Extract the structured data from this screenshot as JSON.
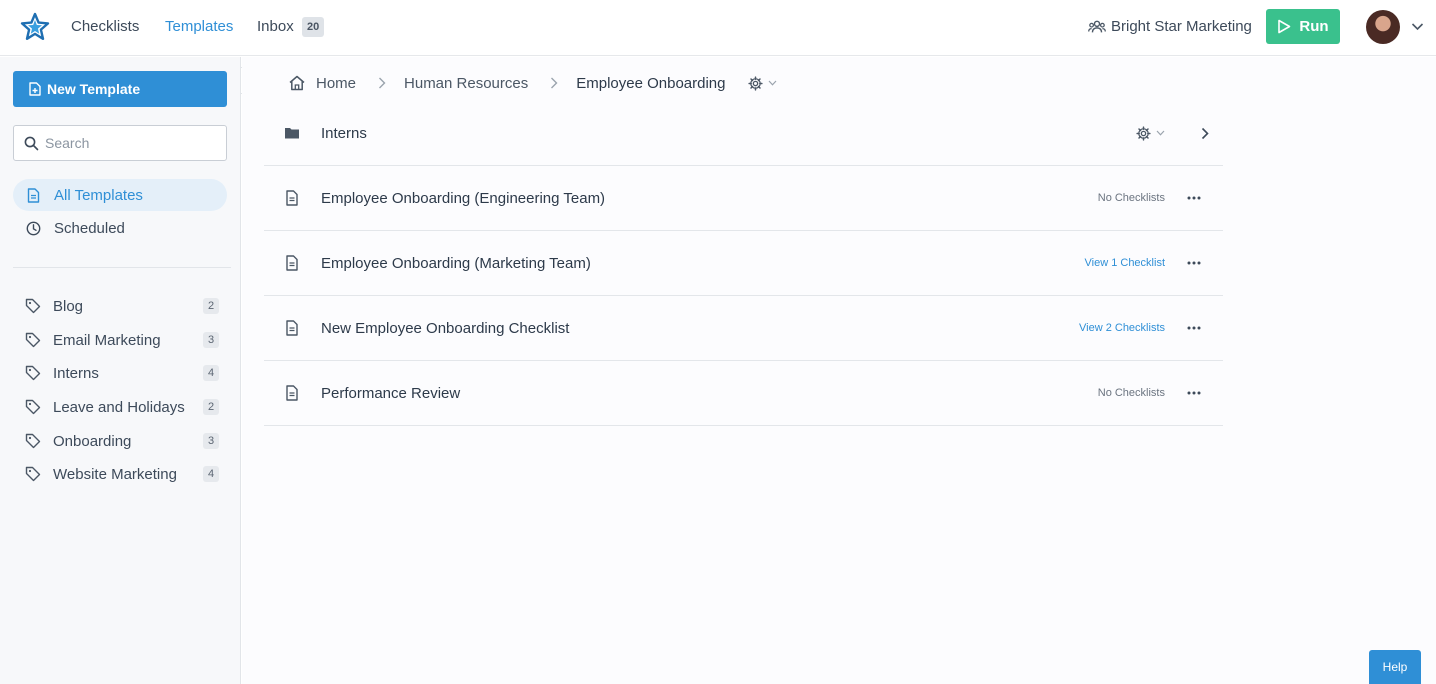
{
  "topbar": {
    "nav": {
      "checklists": "Checklists",
      "templates": "Templates",
      "inbox": "Inbox",
      "inbox_count": "20"
    },
    "organization": "Bright Star Marketing",
    "run_label": "Run"
  },
  "sidebar": {
    "new_template_label": "New Template",
    "search_placeholder": "Search",
    "items": [
      {
        "label": "All Templates",
        "icon": "document-icon",
        "active": true
      },
      {
        "label": "Scheduled",
        "icon": "clock-icon",
        "active": false
      }
    ],
    "tags": [
      {
        "label": "Blog",
        "count": "2"
      },
      {
        "label": "Email Marketing",
        "count": "3"
      },
      {
        "label": "Interns",
        "count": "4"
      },
      {
        "label": "Leave and Holidays",
        "count": "2"
      },
      {
        "label": "Onboarding",
        "count": "3"
      },
      {
        "label": "Website Marketing",
        "count": "4"
      }
    ]
  },
  "breadcrumb": {
    "home": "Home",
    "parent": "Human Resources",
    "current": "Employee Onboarding"
  },
  "list": {
    "folder": {
      "title": "Interns",
      "icon": "folder-icon"
    },
    "templates": [
      {
        "title": "Employee Onboarding (Engineering Team)",
        "status": "No Checklists",
        "is_link": false
      },
      {
        "title": "Employee Onboarding (Marketing Team)",
        "status": "View 1 Checklist",
        "is_link": true
      },
      {
        "title": "New Employee Onboarding Checklist",
        "status": "View 2 Checklists",
        "is_link": true
      },
      {
        "title": "Performance Review",
        "status": "No Checklists",
        "is_link": false
      }
    ]
  },
  "help_label": "Help",
  "colors": {
    "accent": "#2f8fd6",
    "run": "#3ac18d",
    "sidebar_bg": "#f7f8fa"
  }
}
